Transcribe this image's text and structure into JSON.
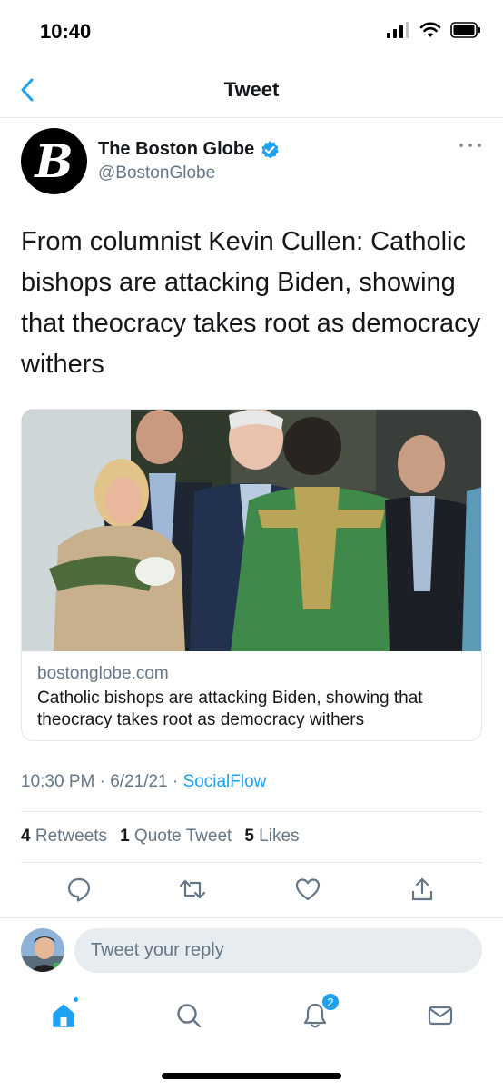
{
  "status_bar": {
    "time": "10:40"
  },
  "nav": {
    "title": "Tweet"
  },
  "author": {
    "avatar_letter": "B",
    "name": "The Boston Globe",
    "handle": "@BostonGlobe",
    "verified": true
  },
  "tweet": {
    "text": "From columnist Kevin Cullen: Catholic bishops are attacking Biden, showing that theocracy takes root as democracy withers"
  },
  "card": {
    "domain": "bostonglobe.com",
    "title": "Catholic bishops are attacking Biden, showing that theocracy takes root as democracy withers"
  },
  "meta": {
    "time": "10:30 PM",
    "date": "6/21/21",
    "separator": "·",
    "source": "SocialFlow"
  },
  "stats": {
    "retweets_count": "4",
    "retweets_label": "Retweets",
    "quotes_count": "1",
    "quotes_label": "Quote Tweet",
    "likes_count": "5",
    "likes_label": "Likes"
  },
  "actions": [
    "reply-icon",
    "retweet-icon",
    "like-icon",
    "share-icon"
  ],
  "reply": {
    "placeholder": "Tweet your reply"
  },
  "tabbar": {
    "tabs": [
      "home-icon",
      "search-icon",
      "notifications-icon",
      "messages-icon"
    ],
    "notifications_badge": "2"
  },
  "colors": {
    "accent": "#1da1f2",
    "text": "#14171a",
    "secondary": "#657786",
    "divider": "#e1e8ed"
  }
}
